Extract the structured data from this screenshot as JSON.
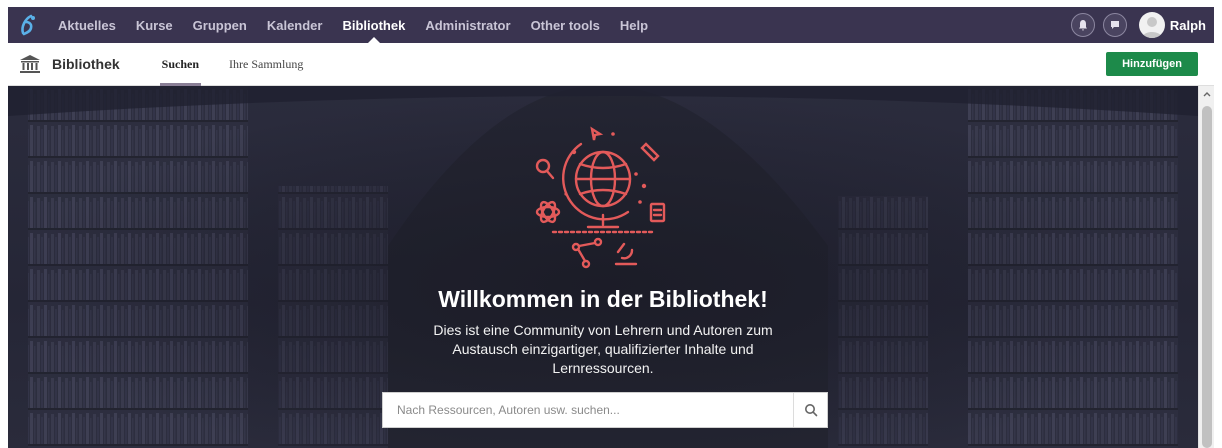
{
  "topnav": {
    "logo_icon": "app-logo-icon",
    "items": [
      {
        "label": "Aktuelles"
      },
      {
        "label": "Kurse"
      },
      {
        "label": "Gruppen"
      },
      {
        "label": "Kalender"
      },
      {
        "label": "Bibliothek",
        "active": true
      },
      {
        "label": "Administrator"
      },
      {
        "label": "Other tools"
      },
      {
        "label": "Help"
      }
    ],
    "notification_icon": "bell-icon",
    "messages_icon": "chat-icon",
    "user": {
      "name": "Ralph",
      "avatar_icon": "avatar-icon"
    }
  },
  "subnav": {
    "icon": "library-building-icon",
    "title": "Bibliothek",
    "tabs": [
      {
        "label": "Suchen",
        "active": true
      },
      {
        "label": "Ihre Sammlung"
      }
    ],
    "add_button": "Hinzufügen"
  },
  "hero": {
    "title": "Willkommen in der Bibliothek!",
    "description": "Dies ist eine Community von Lehrern und Autoren zum Austausch einzigartiger, qualifizierter Inhalte und Lernressourcen.",
    "search_placeholder": "Nach Ressourcen, Autoren usw. suchen...",
    "search_icon": "search-icon",
    "illustration_icon": "globe-illustration-icon"
  },
  "colors": {
    "topbar": "#3a3450",
    "accent_green": "#1d8a4a",
    "illustration": "#e35a5a"
  }
}
